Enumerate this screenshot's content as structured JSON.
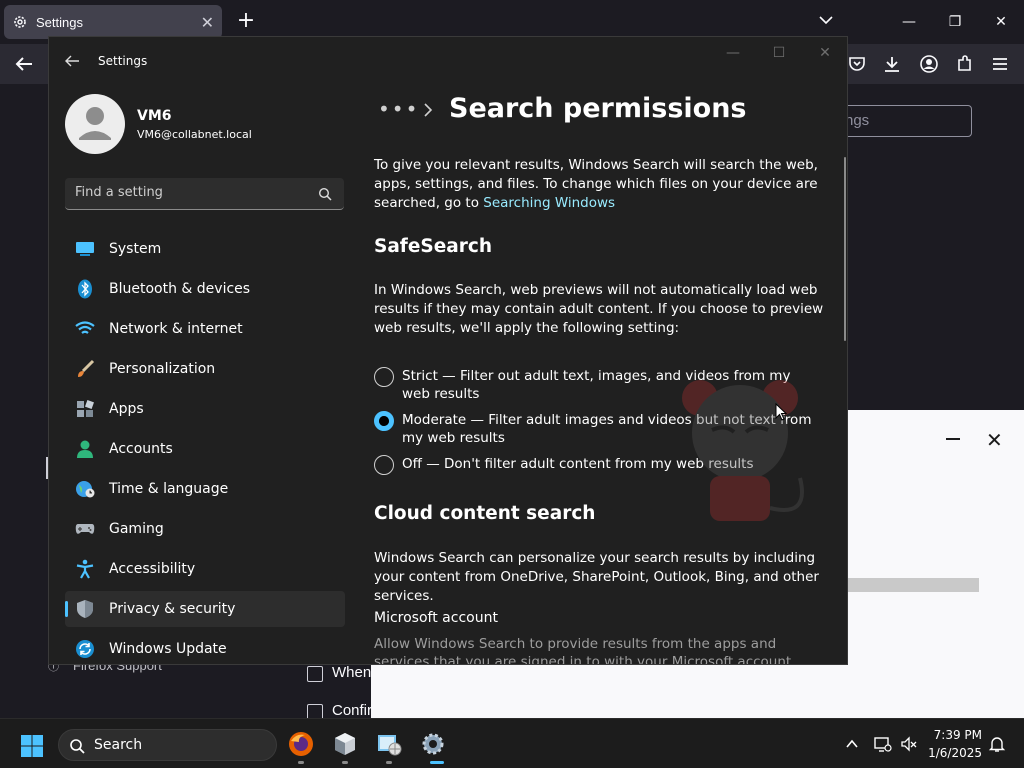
{
  "firefox": {
    "tab_title": "Settings",
    "search_placeholder_partial": "ngs",
    "support_link": "Firefox Support",
    "checkbox_1": "When",
    "checkbox_2": "Confir"
  },
  "settings_window": {
    "title": "Settings",
    "profile": {
      "name": "VM6",
      "email": "VM6@collabnet.local"
    },
    "search_placeholder": "Find a setting",
    "nav": [
      {
        "label": "System",
        "icon": "system-icon"
      },
      {
        "label": "Bluetooth & devices",
        "icon": "bluetooth-icon"
      },
      {
        "label": "Network & internet",
        "icon": "wifi-icon"
      },
      {
        "label": "Personalization",
        "icon": "brush-icon"
      },
      {
        "label": "Apps",
        "icon": "apps-icon"
      },
      {
        "label": "Accounts",
        "icon": "accounts-icon"
      },
      {
        "label": "Time & language",
        "icon": "globe-clock-icon"
      },
      {
        "label": "Gaming",
        "icon": "gamepad-icon"
      },
      {
        "label": "Accessibility",
        "icon": "accessibility-icon"
      },
      {
        "label": "Privacy & security",
        "icon": "shield-icon",
        "selected": true
      },
      {
        "label": "Windows Update",
        "icon": "windows-update-icon"
      }
    ],
    "breadcrumb_more": "•••",
    "page_title": "Search permissions",
    "intro_text": "To give you relevant results, Windows Search will search the web, apps, settings, and files. To change which files on your device are searched, go to",
    "intro_link": "Searching Windows",
    "safesearch": {
      "heading": "SafeSearch",
      "description": "In Windows Search, web previews will not automatically load web results if they may contain adult content. If you choose to preview web results, we'll apply the following setting:",
      "options": [
        {
          "label": "Strict — Filter out adult text, images, and videos from my web results",
          "checked": false
        },
        {
          "label": "Moderate — Filter adult images and videos but not text from my web results",
          "checked": true
        },
        {
          "label": "Off — Don't filter adult content from my web results",
          "checked": false
        }
      ]
    },
    "cloud": {
      "heading": "Cloud content search",
      "description": "Windows Search can personalize your search results by including your content from OneDrive, SharePoint, Outlook, Bing, and other services.",
      "ms_account_heading": "Microsoft account",
      "ms_account_desc": "Allow Windows Search to provide results from the apps and services that you are signed in to with your Microsoft account"
    }
  },
  "taskbar": {
    "search_label": "Search",
    "time": "7:39 PM",
    "date": "1/6/2025"
  },
  "colors": {
    "accent": "#4cc2ff",
    "link": "#99ebff",
    "window_bg": "#202020",
    "selected_nav_bg": "#2d2d2d"
  }
}
